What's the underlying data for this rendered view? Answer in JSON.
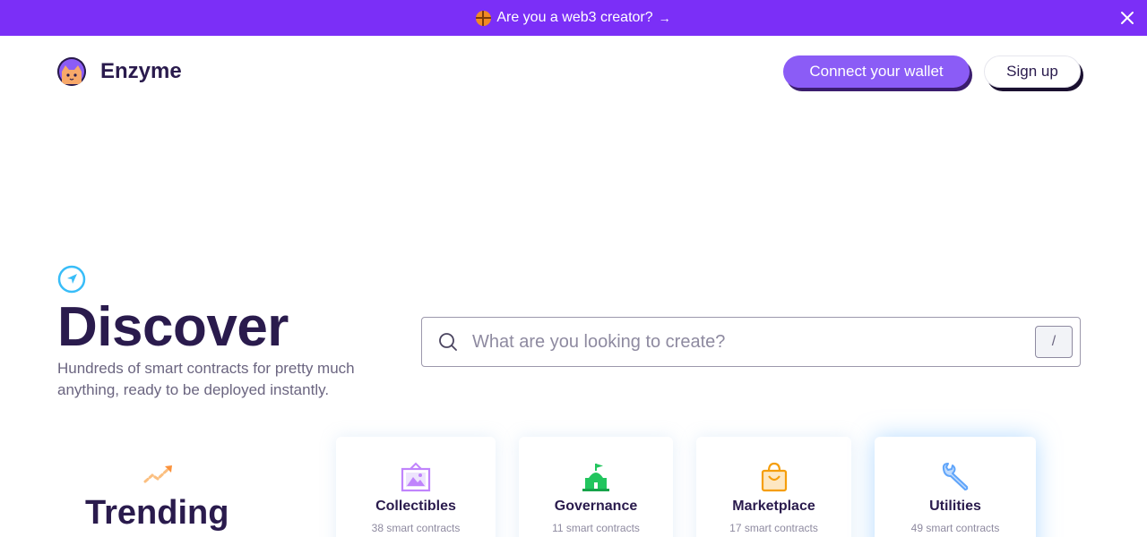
{
  "banner": {
    "text": "Are you a web3 creator?",
    "arrow": "→"
  },
  "brand": {
    "name": "Enzyme"
  },
  "header": {
    "connect_label": "Connect your wallet",
    "signup_label": "Sign up"
  },
  "hero": {
    "title": "Discover",
    "subtitle": "Hundreds of smart contracts for pretty much anything, ready to be deployed instantly."
  },
  "search": {
    "placeholder": "What are you looking to create?",
    "shortcut": "/"
  },
  "trending": {
    "title": "Trending"
  },
  "categories": [
    {
      "name": "Collectibles",
      "count": "38 smart contracts",
      "icon": "picture-frame-icon",
      "color": "#c084fc"
    },
    {
      "name": "Governance",
      "count": "11 smart contracts",
      "icon": "capitol-flag-icon",
      "color": "#22c55e"
    },
    {
      "name": "Marketplace",
      "count": "17 smart contracts",
      "icon": "shopping-bag-icon",
      "color": "#f59e0b"
    },
    {
      "name": "Utilities",
      "count": "49 smart contracts",
      "icon": "wrench-icon",
      "color": "#60a5fa"
    }
  ],
  "colors": {
    "banner": "#7b2ff7",
    "primary": "#8b5cf6",
    "ink": "#2a1b4d"
  }
}
